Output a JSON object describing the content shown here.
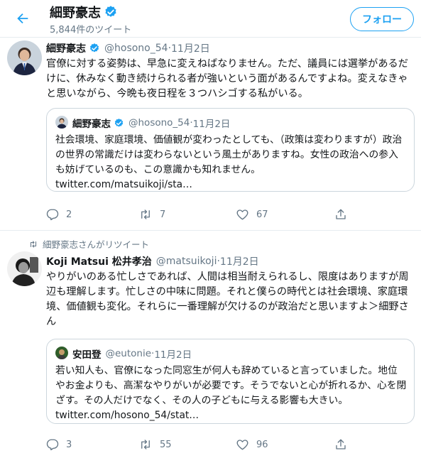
{
  "header": {
    "title": "細野豪志",
    "tweet_count": "5,844件のツイート",
    "follow_label": "フォロー"
  },
  "tweets": [
    {
      "name": "細野豪志",
      "handle": "@hosono_54",
      "sep": " · ",
      "date": "11月2日",
      "text": "官僚に対する姿勢は、早急に変えねばなりません。ただ、議員には選挙があるだけに、休みなく動き続けられる者が強いという面があるんですよね。変えなきゃと思いながら、今晩も夜日程を３つハシゴする私がいる。",
      "quote": {
        "name": "細野豪志",
        "handle": "@hosono_54",
        "sep": " · ",
        "date": "11月2日",
        "text": "社会環境、家庭環境、価値観が変わったとしても、（政策は変わりますが）政治の世界の常識だけは変わらないという風土がありますね。女性の政治への参入も妨げているのも、この意識かも知れません。",
        "link": "twitter.com/matsuikoji/sta…"
      },
      "replies": "2",
      "retweets": "7",
      "likes": "67"
    },
    {
      "retweet_note": "細野豪志さんがリツイート",
      "name": "Koji Matsui 松井孝治",
      "handle": "@matsuikoji",
      "sep": " · ",
      "date": "11月2日",
      "text": "やりがいのある忙しさであれば、人間は相当耐えられるし、限度はありますが周辺も理解します。忙しさの中味に問題。それと僕らの時代とは社会環境、家庭環境、価値観も変化。それらに一番理解が欠けるのが政治だと思いますよ＞細野さん",
      "quote": {
        "name": "安田登",
        "handle": "@eutonie",
        "sep": " · ",
        "date": "11月2日",
        "text": "若い知人も、官僚になった同窓生が何人も辞めていると言っていました。地位やお金よりも、高潔なやりがいが必要です。そうでないと心が折れるか、心を閉ざす。その人だけでなく、その人の子どもに与える影響も大きい。",
        "link": " twitter.com/hosono_54/stat…"
      },
      "replies": "3",
      "retweets": "55",
      "likes": "96"
    }
  ],
  "colors": {
    "accent": "#1da1f2",
    "text": "#14171a",
    "muted": "#657786",
    "border": "#e6ecf0"
  },
  "icons": [
    "back-arrow-icon",
    "verified-badge-icon",
    "reply-icon",
    "retweet-icon",
    "like-icon",
    "share-icon"
  ]
}
